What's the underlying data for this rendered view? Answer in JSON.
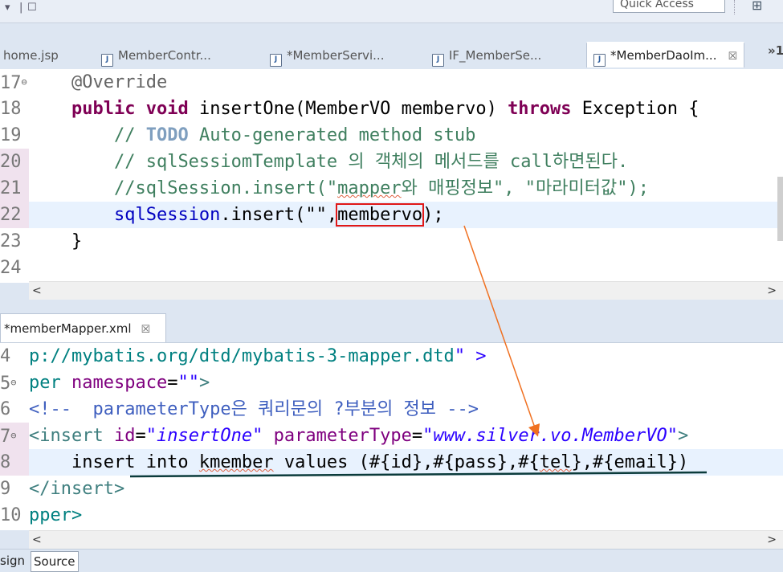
{
  "toolbar": {
    "quick_access": "Quick Access"
  },
  "tabs": [
    {
      "label": "home.jsp",
      "icon": "jsp-file-icon"
    },
    {
      "label": "MemberContr...",
      "icon": "java-file-icon"
    },
    {
      "label": "*MemberServi...",
      "icon": "java-file-icon"
    },
    {
      "label": "IF_MemberSe...",
      "icon": "java-file-icon"
    },
    {
      "label": "*MemberDaoIm...",
      "icon": "java-file-icon",
      "active": true
    }
  ],
  "tabs_more": "»1",
  "editor1": {
    "line_numbers": [
      "17",
      "18",
      "19",
      "20",
      "21",
      "22",
      "23",
      "24"
    ],
    "code": {
      "l17": "@Override",
      "l18_kw1": "public",
      "l18_kw2": "void",
      "l18_name": " insertOne(MemberVO membervo) ",
      "l18_kw3": "throws",
      "l18_tail": " Exception {",
      "l19_a": "// ",
      "l19_todo": "TODO",
      "l19_b": " Auto-generated method stub",
      "l20": "// sqlSessiomTemplate 의 객체의 메서드를 call하면된다.",
      "l21_a": "//sqlSession.insert(\"",
      "l21_sq": "mapper",
      "l21_b": "와 매핑정보\", \"마라미터값\");",
      "l22_a": "sqlSession",
      "l22_b": ".insert(\"\",",
      "l22_box": "membervo",
      "l22_c": ");",
      "l23": "}"
    }
  },
  "editor2_tab": {
    "label": "*memberMapper.xml"
  },
  "editor2": {
    "line_numbers": [
      "4",
      "5",
      "6",
      "7",
      "8",
      "9",
      "10"
    ],
    "code": {
      "l4_a": "p://mybatis.org/dtd/mybatis-3-mapper.dtd",
      "l4_b": "\" >",
      "l5_a": "per ",
      "l5_attr": "namespace",
      "l5_eq": "=",
      "l5_val": "\"\"",
      "l5_end": ">",
      "l6": "<!--  parameterType은 쿼리문의 ?부분의 정보 -->",
      "l7_open": "<insert ",
      "l7_id": "id",
      "l7_eq1": "=",
      "l7_idval": "\"insertOne\"",
      "l7_pt": " parameterType",
      "l7_eq2": "=",
      "l7_ptval": "\"www.silver.vo.MemberVO\"",
      "l7_close": ">",
      "l8_a": "    insert into ",
      "l8_sq": "kmember",
      "l8_b": " values (#{id},#{pass},#{",
      "l8_tel": "tel",
      "l8_c": "},#{email})",
      "l9": "</insert>",
      "l10": "pper>"
    }
  },
  "bottom_tabs": [
    {
      "label": "sign"
    },
    {
      "label": "Source",
      "active": true
    }
  ]
}
